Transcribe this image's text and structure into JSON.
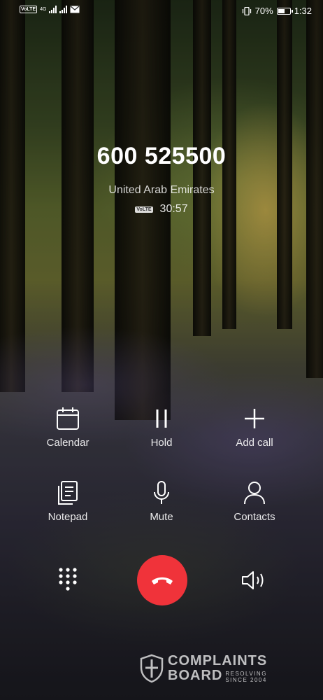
{
  "status_bar": {
    "volte_badge": "VoLTE",
    "network_4g": "4G",
    "battery_percent": "70%",
    "battery_level": 0.7,
    "time": "1:32"
  },
  "call": {
    "number": "600 525500",
    "location": "United Arab Emirates",
    "volte_badge": "VoLTE",
    "duration": "30:57"
  },
  "actions": {
    "calendar": "Calendar",
    "hold": "Hold",
    "add_call": "Add call",
    "notepad": "Notepad",
    "mute": "Mute",
    "contacts": "Contacts"
  },
  "controls": {
    "dialpad_icon": "dialpad-icon",
    "end_call_icon": "end-call-icon",
    "speaker_icon": "speaker-icon",
    "end_call_color": "#f0333a"
  },
  "watermark": {
    "line1": "COMPLAINTS",
    "line2": "BOARD",
    "tagline_1": "RESOLVING",
    "tagline_2": "SINCE 2004"
  }
}
